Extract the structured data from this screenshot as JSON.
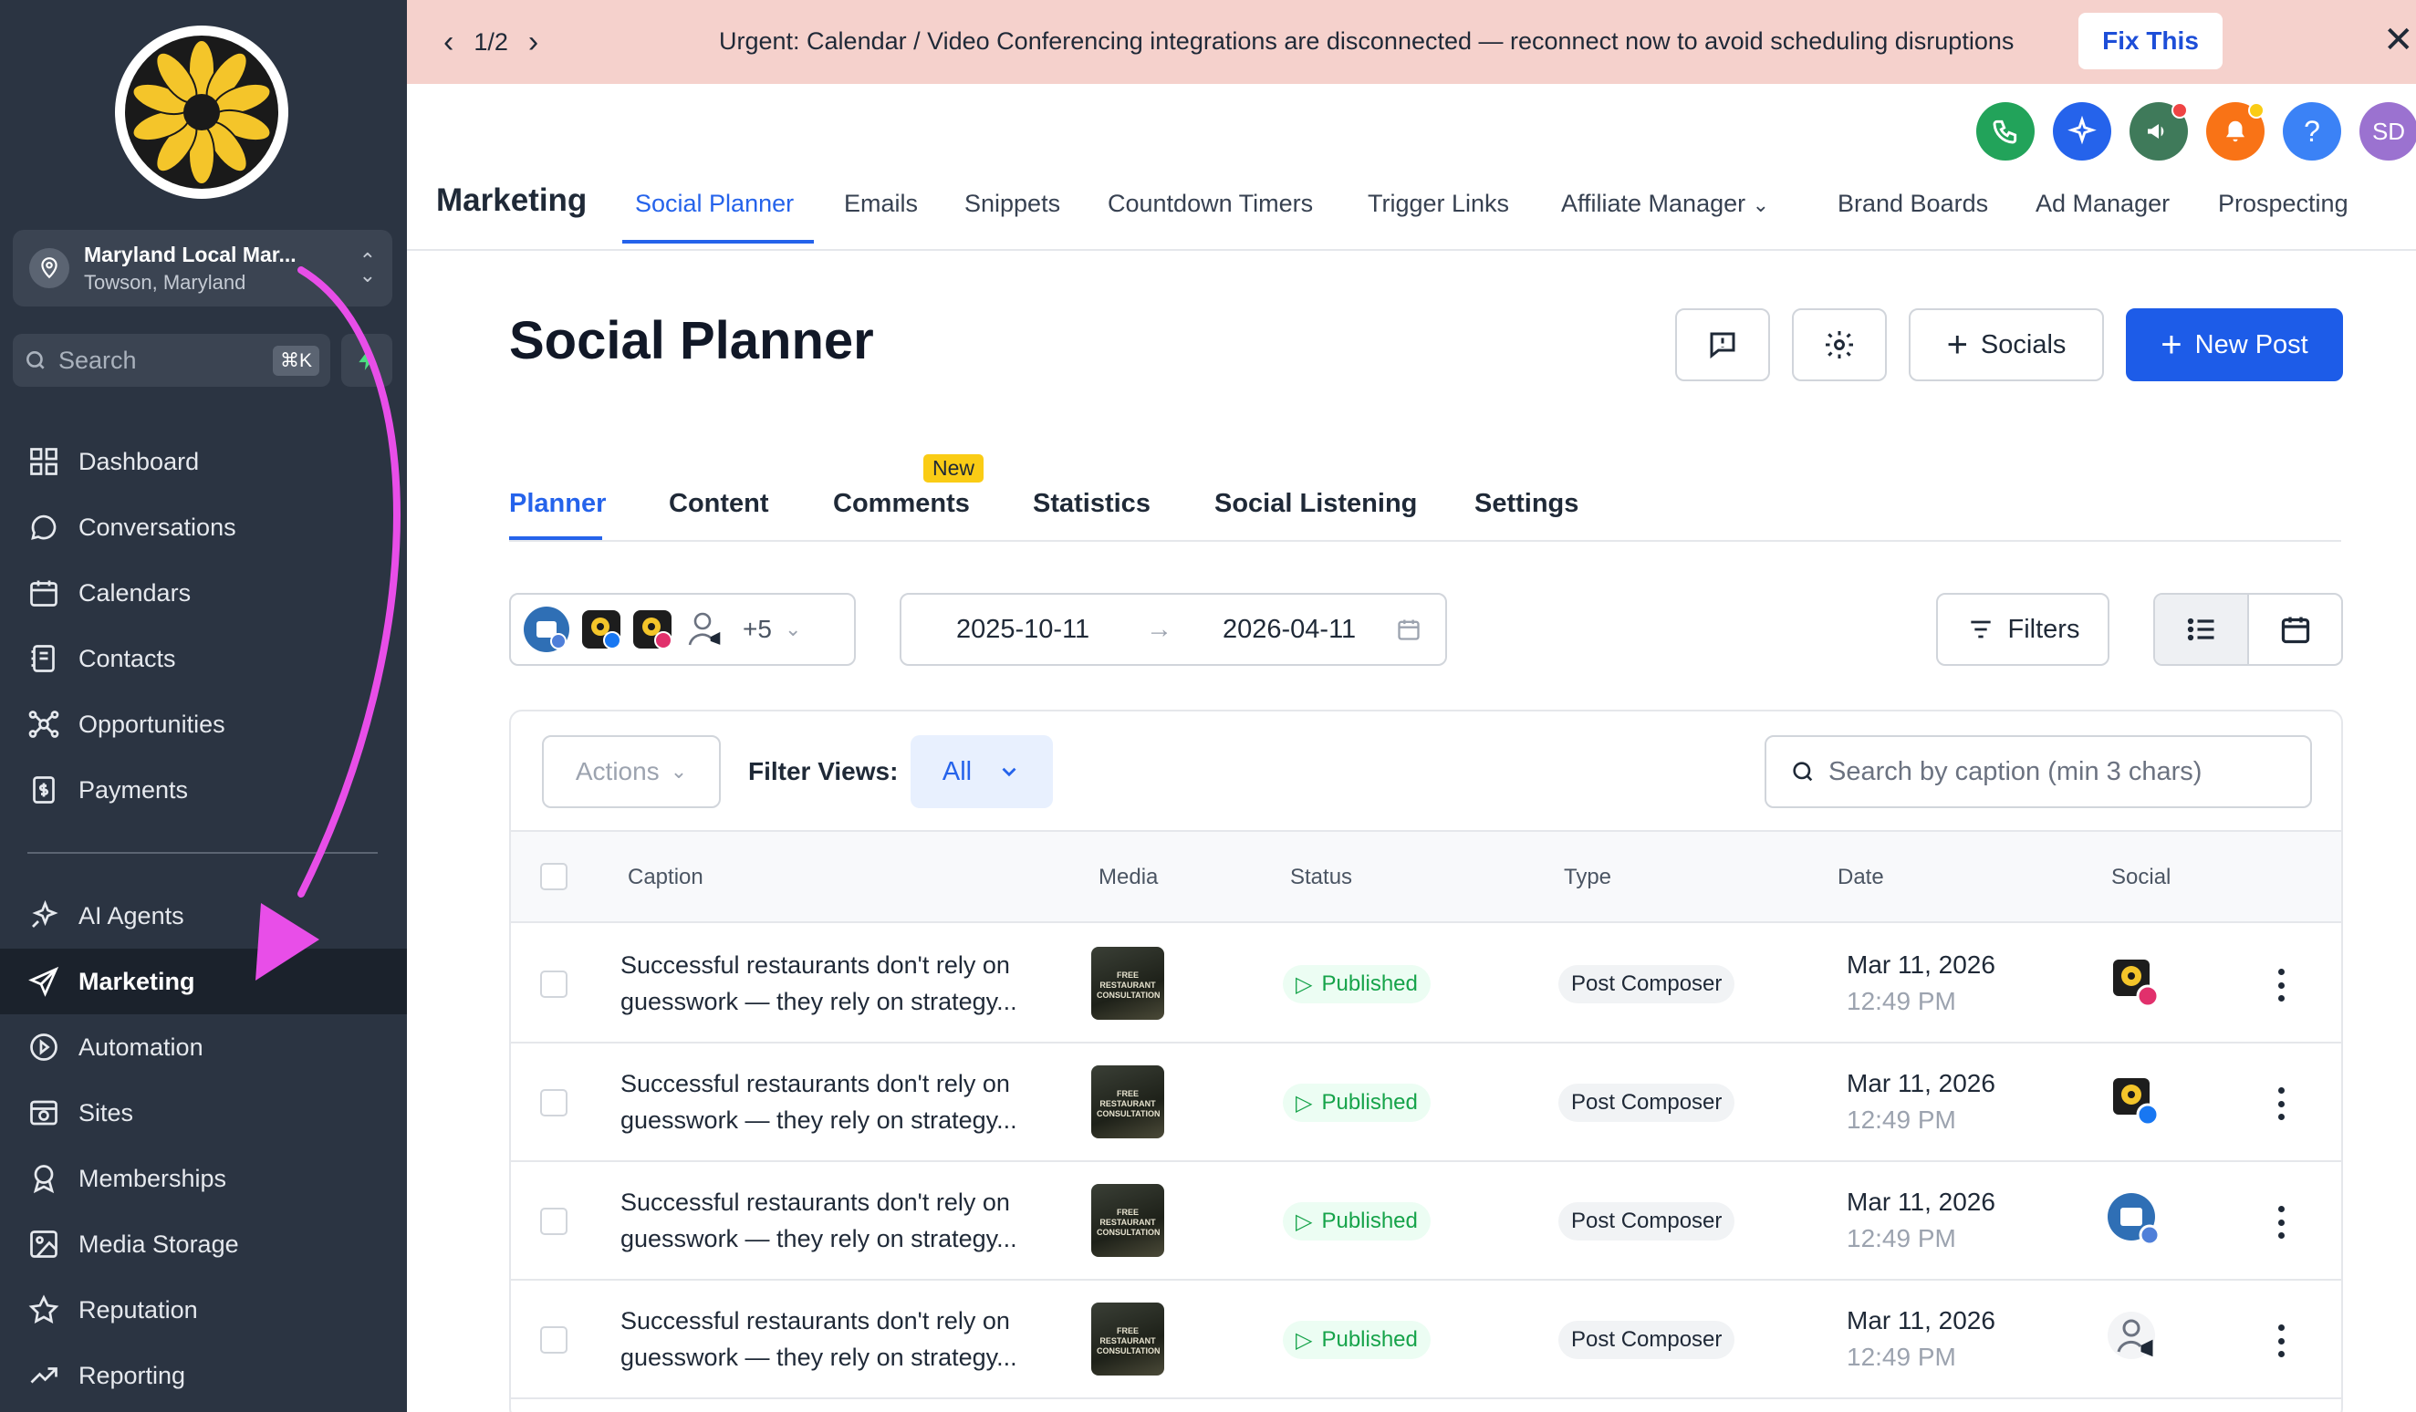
{
  "sidebar": {
    "account": {
      "name": "Maryland Local Mar...",
      "location": "Towson, Maryland"
    },
    "search": {
      "placeholder": "Search",
      "shortcut": "⌘K"
    },
    "items": [
      {
        "label": "Dashboard",
        "icon": "dashboard-icon"
      },
      {
        "label": "Conversations",
        "icon": "chat-bubble-icon"
      },
      {
        "label": "Calendars",
        "icon": "calendar-icon"
      },
      {
        "label": "Contacts",
        "icon": "contacts-icon"
      },
      {
        "label": "Opportunities",
        "icon": "opportunities-icon"
      },
      {
        "label": "Payments",
        "icon": "payments-icon"
      }
    ],
    "items2": [
      {
        "label": "AI Agents",
        "icon": "ai-sparkle-icon"
      },
      {
        "label": "Marketing",
        "icon": "paper-plane-icon",
        "active": true
      },
      {
        "label": "Automation",
        "icon": "automation-icon"
      },
      {
        "label": "Sites",
        "icon": "sites-icon"
      },
      {
        "label": "Memberships",
        "icon": "memberships-icon"
      },
      {
        "label": "Media Storage",
        "icon": "image-icon"
      },
      {
        "label": "Reputation",
        "icon": "star-icon"
      },
      {
        "label": "Reporting",
        "icon": "trend-icon"
      }
    ]
  },
  "banner": {
    "pager": "1/2",
    "message": "Urgent: Calendar / Video Conferencing integrations are disconnected — reconnect now to avoid scheduling disruptions",
    "fix_label": "Fix This"
  },
  "topbar": {
    "avatar_initials": "SD",
    "help": "?"
  },
  "module": {
    "title": "Marketing",
    "tabs": [
      "Social Planner",
      "Emails",
      "Snippets",
      "Countdown Timers",
      "Trigger Links",
      "Affiliate Manager",
      "Brand Boards",
      "Ad Manager",
      "Prospecting"
    ],
    "active_tab": "Social Planner"
  },
  "page": {
    "title": "Social Planner",
    "socials_label": "Socials",
    "new_post_label": "New Post"
  },
  "subtabs": {
    "items": [
      "Planner",
      "Content",
      "Comments",
      "Statistics",
      "Social Listening",
      "Settings"
    ],
    "active": "Planner",
    "badge": "New"
  },
  "filters": {
    "accounts_more": "+5",
    "date_from": "2025-10-11",
    "date_to": "2026-04-11",
    "filters_label": "Filters"
  },
  "table": {
    "actions_label": "Actions",
    "filter_views_label": "Filter Views:",
    "filter_views_value": "All",
    "search_placeholder": "Search by caption (min 3 chars)",
    "columns": [
      "Caption",
      "Media",
      "Status",
      "Type",
      "Date",
      "Social"
    ],
    "media_thumb_text": "FREE RESTAURANT CONSULTATION",
    "rows": [
      {
        "caption_l1": "Successful restaurants don't rely on",
        "caption_l2": "guesswork — they rely on strategy...",
        "status": "Published",
        "type": "Post Composer",
        "date": "Mar 11, 2026",
        "time": "12:49 PM",
        "social": "instagram"
      },
      {
        "caption_l1": "Successful restaurants don't rely on",
        "caption_l2": "guesswork — they rely on strategy...",
        "status": "Published",
        "type": "Post Composer",
        "date": "Mar 11, 2026",
        "time": "12:49 PM",
        "social": "facebook"
      },
      {
        "caption_l1": "Successful restaurants don't rely on",
        "caption_l2": "guesswork — they rely on strategy...",
        "status": "Published",
        "type": "Post Composer",
        "date": "Mar 11, 2026",
        "time": "12:49 PM",
        "social": "google-business"
      },
      {
        "caption_l1": "Successful restaurants don't rely on",
        "caption_l2": "guesswork — they rely on strategy...",
        "status": "Published",
        "type": "Post Composer",
        "date": "Mar 11, 2026",
        "time": "12:49 PM",
        "social": "community"
      }
    ]
  },
  "colors": {
    "sidebar": "#2b3442",
    "accent": "#2563eb",
    "banner": "#f5d1cc",
    "annotation_arrow": "#e84ee8"
  }
}
